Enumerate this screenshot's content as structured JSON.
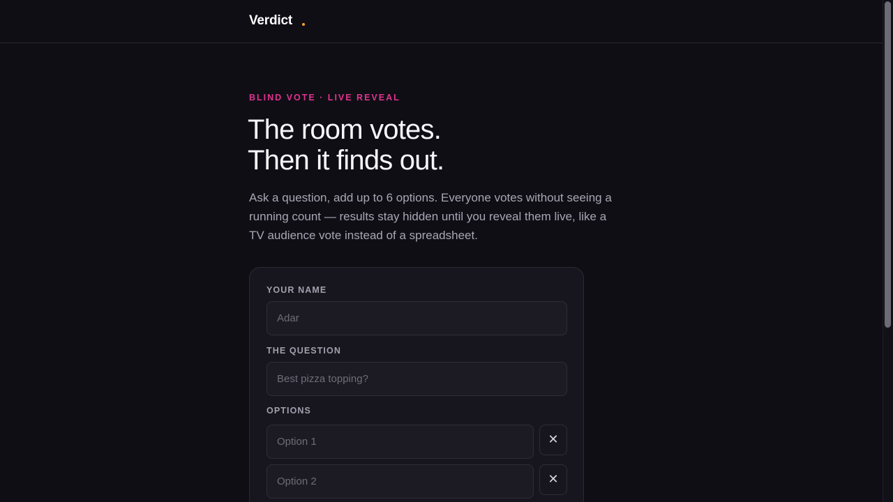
{
  "header": {
    "brand": "Verdict",
    "brand_accent_color": "#f5a524"
  },
  "hero": {
    "eyebrow": "BLIND VOTE · LIVE REVEAL",
    "eyebrow_color": "#e0338f",
    "headline_line1": "The room votes.",
    "headline_line2": "Then it finds out.",
    "intro": "Ask a question, add up to 6 options. Everyone votes without seeing a running count — results stay hidden until you reveal them live, like a TV audience vote instead of a spreadsheet."
  },
  "form": {
    "name_label": "YOUR NAME",
    "name_placeholder": "Adar",
    "name_value": "",
    "question_label": "THE QUESTION",
    "question_placeholder": "Best pizza topping?",
    "question_value": "",
    "options_label": "OPTIONS",
    "options": [
      {
        "placeholder": "Option 1",
        "value": "",
        "remove_icon": "close-icon",
        "remove_glyph": "✕"
      },
      {
        "placeholder": "Option 2",
        "value": "",
        "remove_icon": "close-icon",
        "remove_glyph": "✕"
      }
    ]
  }
}
